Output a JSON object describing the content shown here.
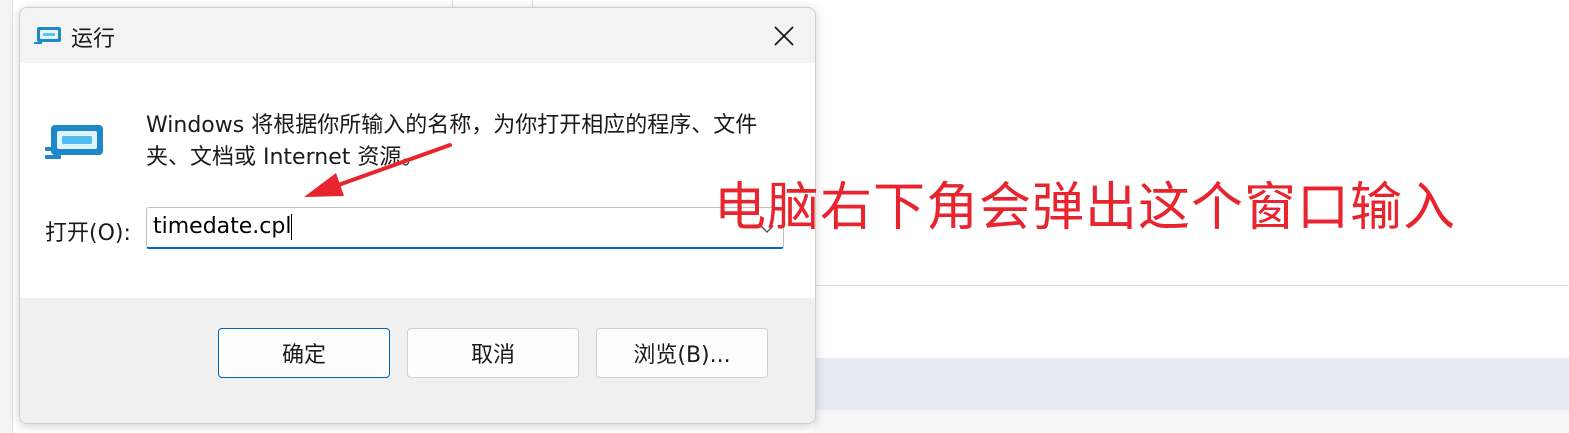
{
  "dialog": {
    "title": "运行",
    "description": "Windows 将根据你所输入的名称，为你打开相应的程序、文件夹、文档或 Internet 资源。",
    "open_label": "打开(O):",
    "input_value": "timedate.cpl",
    "buttons": {
      "ok": "确定",
      "cancel": "取消",
      "browse": "浏览(B)..."
    },
    "icons": {
      "title": "run-icon",
      "close": "close-icon",
      "dropdown": "chevron-down-icon"
    }
  },
  "annotation": {
    "text": "电脑右下角会弹出这个窗口输入",
    "color": "#e8242e"
  },
  "colors": {
    "accent": "#0067c0",
    "annotation": "#e8242e"
  }
}
